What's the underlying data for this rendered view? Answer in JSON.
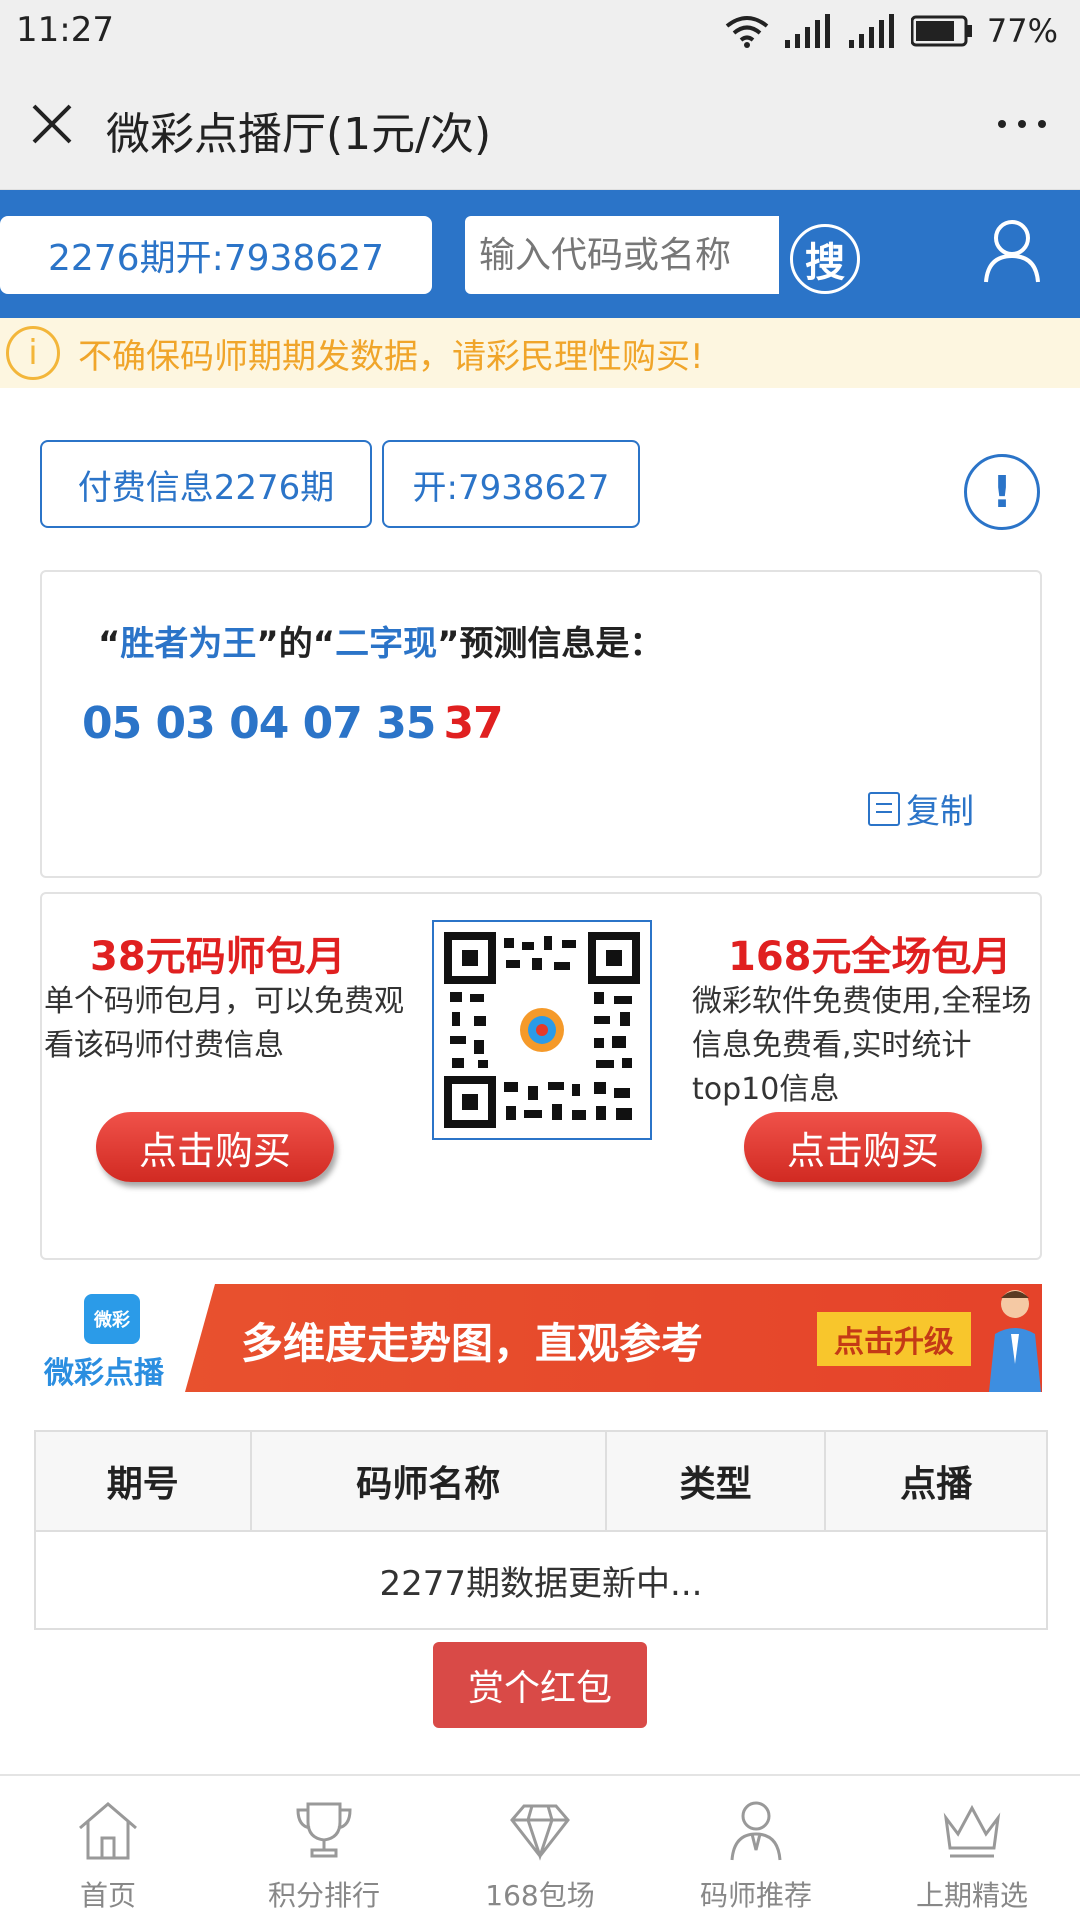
{
  "status_bar": {
    "time": "11:27",
    "battery": "77%"
  },
  "title_bar": {
    "title": "微彩点播厅(1元/次)"
  },
  "header": {
    "period_label": "2276期开:7938627",
    "search_placeholder": "输入代码或名称",
    "search_button": "搜"
  },
  "warning": {
    "text": "不确保码师期期发数据，请彩民理性购买!"
  },
  "info": {
    "paid_label": "付费信息2276期",
    "open_label": "开:7938627"
  },
  "prediction": {
    "quote_open": "“",
    "master": "胜者为王",
    "quote_close": "”",
    "connector": "的",
    "type": "二字现",
    "suffix": "预测信息是：",
    "numbers": "05 03 04 07 35",
    "last_number": "37",
    "copy_label": "复制"
  },
  "packages": {
    "left_title": "38元码师包月",
    "left_desc": "单个码师包月，可以免费观看该码师付费信息",
    "left_button": "点击购买",
    "right_title": "168元全场包月",
    "right_desc": "微彩软件免费使用,全程场信息免费看,实时统计top10信息",
    "right_button": "点击购买"
  },
  "banner": {
    "logo_badge": "微彩",
    "logo_text": "微彩点播",
    "text": "多维度走势图，直观参考",
    "button": "点击升级"
  },
  "table": {
    "headers": [
      "期号",
      "码师名称",
      "类型",
      "点播"
    ],
    "status": "2277期数据更新中..."
  },
  "red_button": "赏个红包",
  "bottom_nav": [
    {
      "label": "首页",
      "icon": "home-icon"
    },
    {
      "label": "积分排行",
      "icon": "trophy-icon"
    },
    {
      "label": "168包场",
      "icon": "diamond-icon"
    },
    {
      "label": "码师推荐",
      "icon": "person-icon"
    },
    {
      "label": "上期精选",
      "icon": "crown-icon"
    }
  ],
  "colors": {
    "brand_blue": "#2b74c8",
    "accent_red": "#e02020",
    "warning_orange": "#f0a52a"
  }
}
